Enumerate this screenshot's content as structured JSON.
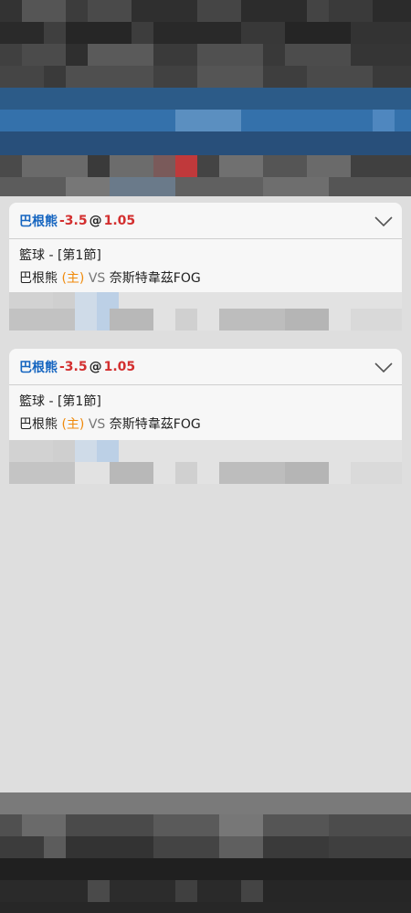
{
  "bets": [
    {
      "team": "巴根熊",
      "handicap": "-3.5",
      "at": "@",
      "odds": "1.05",
      "sport_period": "籃球 - [第1節]",
      "home_team": "巴根熊",
      "home_marker": "(主)",
      "vs": "VS",
      "away_team": "奈斯特韋茲FOG"
    },
    {
      "team": "巴根熊",
      "handicap": "-3.5",
      "at": "@",
      "odds": "1.05",
      "sport_period": "籃球 - [第1節]",
      "home_team": "巴根熊",
      "home_marker": "(主)",
      "vs": "VS",
      "away_team": "奈斯特韋茲FOG"
    }
  ],
  "icons": {
    "expand": "chevron-down-icon"
  },
  "colors": {
    "team": "#1565c0",
    "odds": "#d32f2f",
    "home_marker": "#f08a0a",
    "accent_band": "#3471ab"
  }
}
